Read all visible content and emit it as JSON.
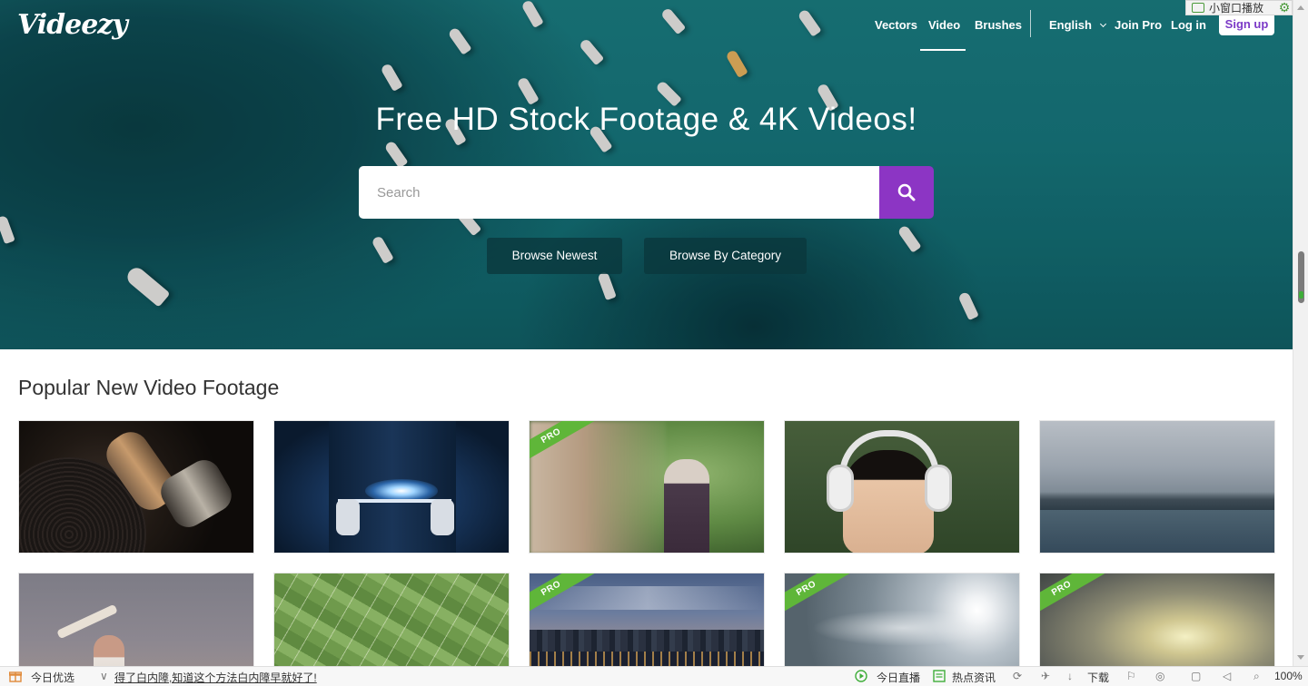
{
  "header": {
    "logo": "Videezy",
    "nav": [
      "Vectors",
      "Video",
      "Brushes"
    ],
    "active_nav": "Video",
    "language": "English",
    "join_pro": "Join Pro",
    "login": "Log in",
    "signup": "Sign up"
  },
  "browser_overlay": {
    "mini_window_label": "小窗口播放"
  },
  "hero": {
    "title": "Free HD Stock Footage & 4K Videos!",
    "search_placeholder": "Search",
    "browse_newest": "Browse Newest",
    "browse_category": "Browse By Category"
  },
  "section": {
    "title": "Popular New Video Footage"
  },
  "thumbnails": [
    {
      "pro": false,
      "badge": ""
    },
    {
      "pro": false,
      "badge": ""
    },
    {
      "pro": true,
      "badge": "PRO"
    },
    {
      "pro": false,
      "badge": ""
    },
    {
      "pro": false,
      "badge": ""
    },
    {
      "pro": false,
      "badge": ""
    },
    {
      "pro": false,
      "badge": ""
    },
    {
      "pro": true,
      "badge": "PRO"
    },
    {
      "pro": true,
      "badge": "PRO"
    },
    {
      "pro": true,
      "badge": "PRO"
    }
  ],
  "statusbar": {
    "left_label": "今日优选",
    "news_link": "得了白内障,知道这个方法白内障早就好了!",
    "live": "今日直播",
    "hot_news": "热点资讯",
    "download": "下载",
    "zoom": "100%"
  },
  "colors": {
    "accent": "#8c35c4",
    "pro_badge": "#5fb639",
    "signup_text": "#7b39c7"
  }
}
